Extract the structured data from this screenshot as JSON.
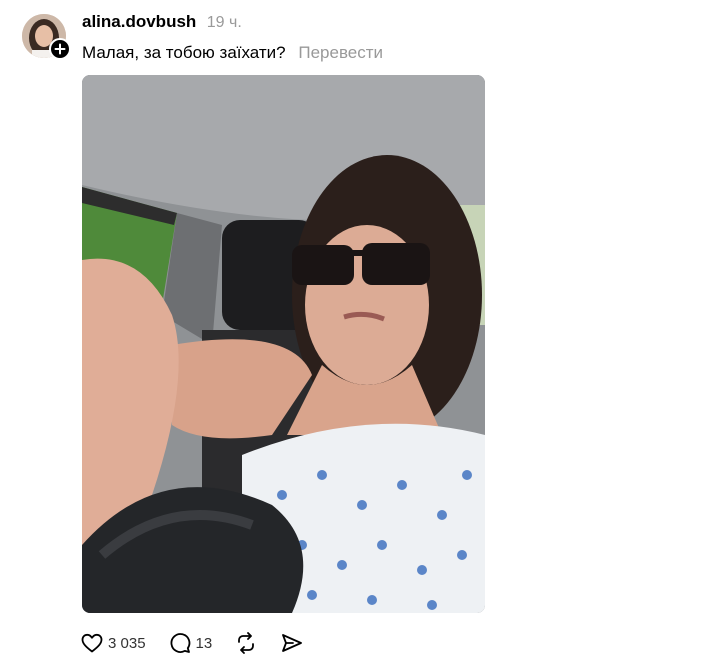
{
  "post": {
    "username": "alina.dovbush",
    "timestamp": "19 ч.",
    "caption": "Малая, за тобою заїхати?",
    "translate_label": "Перевести",
    "media_alt": "video-post"
  },
  "actions": {
    "likes": "3 035",
    "replies": "13"
  },
  "icons": {
    "like": "heart-icon",
    "reply": "comment-icon",
    "repost": "repost-icon",
    "share": "send-icon",
    "follow": "plus-icon"
  },
  "colors": {
    "text": "#000000",
    "muted": "#999999",
    "background": "#ffffff"
  }
}
